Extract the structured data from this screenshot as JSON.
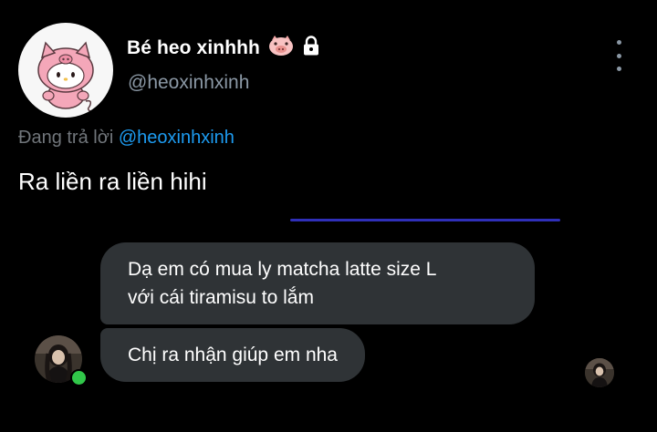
{
  "profile": {
    "display_name": "Bé heo xinhhh",
    "handle": "@heoxinhxinh"
  },
  "tweet": {
    "reply_prefix": "Đang trả lời",
    "reply_mention": "@heoxinhxinh",
    "text": "Ra liền ra liền hihi"
  },
  "messages": [
    {
      "lines": [
        "Dạ em có mua ly matcha latte size L",
        "với cái tiramisu to lắm"
      ]
    },
    {
      "lines": [
        "Chị ra nhận giúp em nha"
      ]
    }
  ],
  "icons": {
    "pig": "pig-face-icon",
    "lock": "lock-icon",
    "more": "more-vertical-icon"
  },
  "colors": {
    "background": "#000000",
    "bubble": "#2f3336",
    "mention": "#1d9bf0",
    "muted": "#8b98a5",
    "divider": "#2f2fb8",
    "online": "#31c74a"
  }
}
